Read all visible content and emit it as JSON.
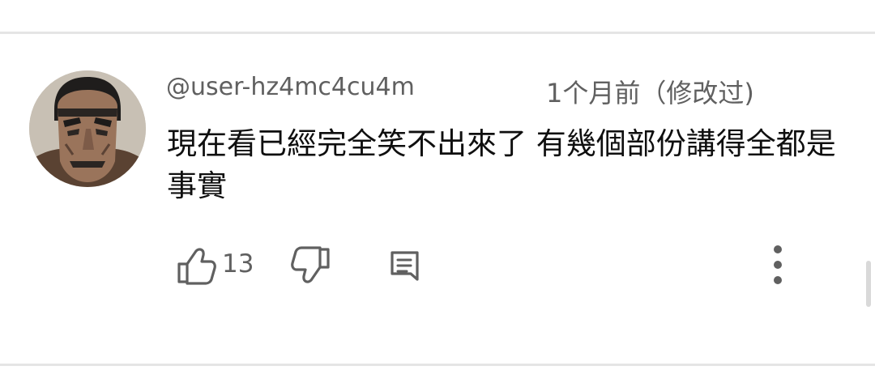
{
  "comment": {
    "author": "@user-hz4mc4cu4m",
    "timestamp": "1个月前（修改过)",
    "text": "現在看已經完全笑不出來了 有幾個部份講得全都是事實",
    "avatar": "avatar-illustrated-face"
  },
  "actions": {
    "like_count": "13",
    "like_icon": "thumb-up-icon",
    "dislike_icon": "thumb-down-icon",
    "reply_icon": "comment-reply-icon",
    "more_icon": "more-vertical-icon"
  },
  "colors": {
    "primary_text": "#0f0f0f",
    "secondary_text": "#606060",
    "divider": "#e5e5e5",
    "icon": "#606060"
  }
}
